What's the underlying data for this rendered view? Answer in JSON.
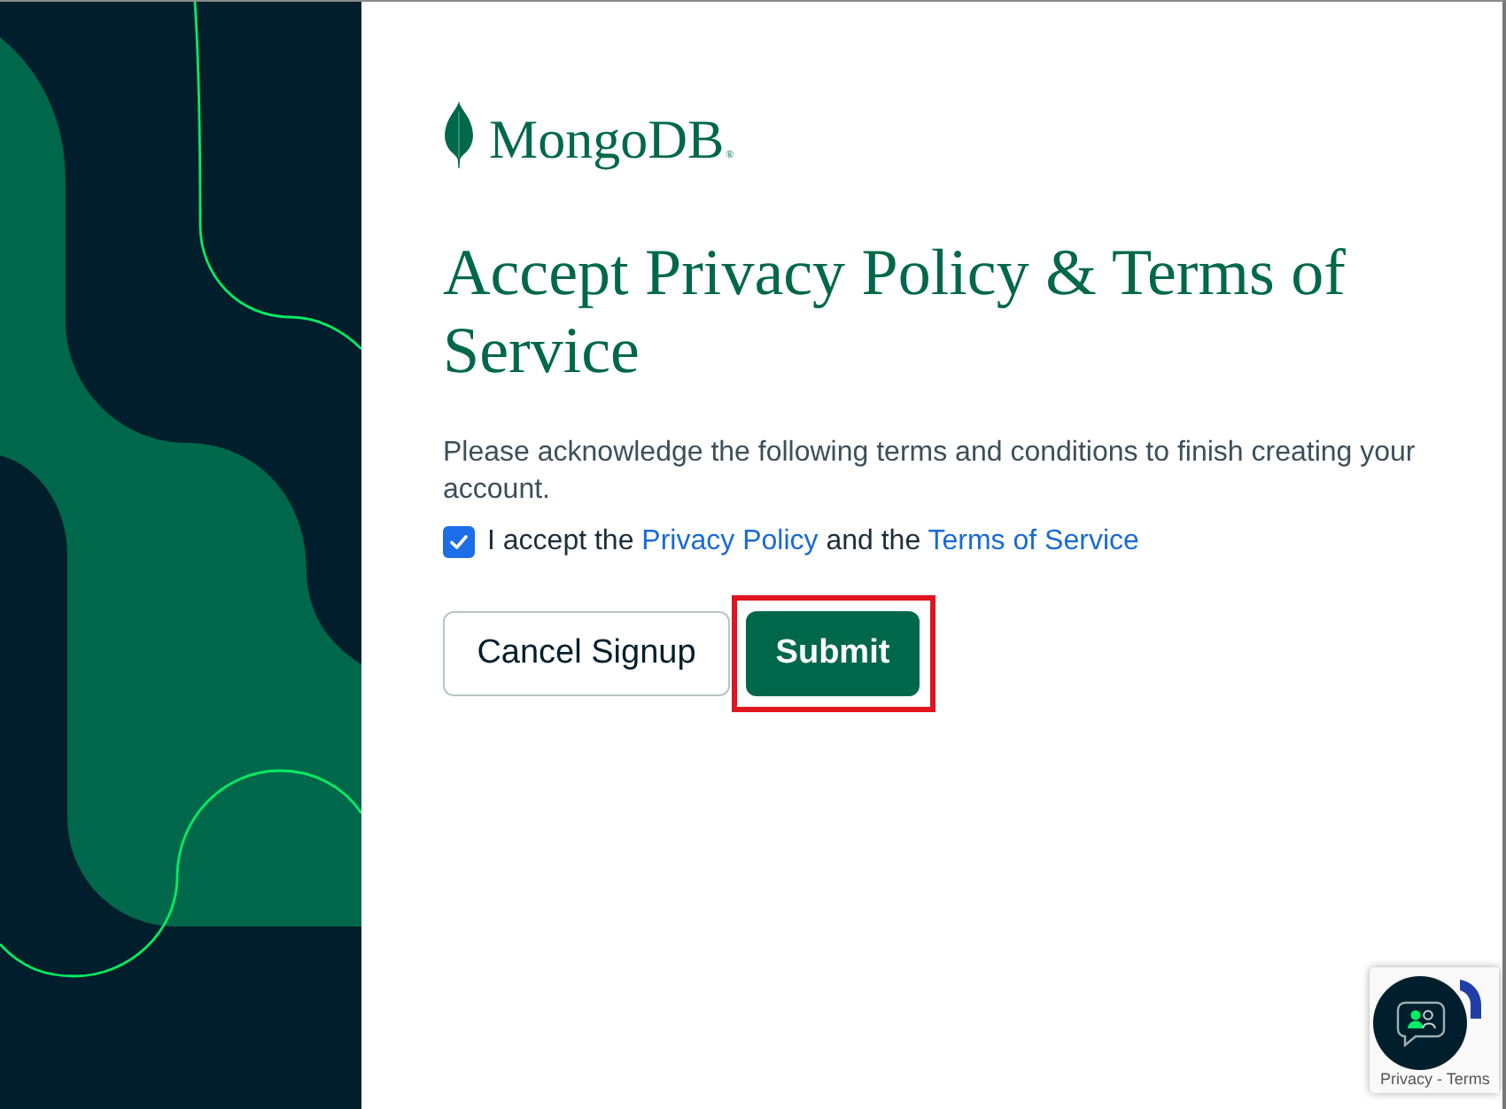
{
  "logo": {
    "wordmark": "MongoDB",
    "mark": "®"
  },
  "heading": "Accept Privacy Policy & Terms of Service",
  "intro": "Please acknowledge the following terms and conditions to finish creating your account.",
  "consent": {
    "checked": true,
    "parts": [
      {
        "kind": "text",
        "text": "I accept the"
      },
      {
        "kind": "link",
        "text": "Privacy Policy"
      },
      {
        "kind": "text",
        "text": "and the"
      },
      {
        "kind": "link",
        "text": "Terms of Service"
      }
    ]
  },
  "buttons": [
    {
      "kind": "secondary",
      "label": "Cancel Signup",
      "highlighted": false
    },
    {
      "kind": "primary",
      "label": "Submit",
      "highlighted": true
    }
  ],
  "captcha_badge": {
    "links_text": "Privacy - Terms"
  }
}
